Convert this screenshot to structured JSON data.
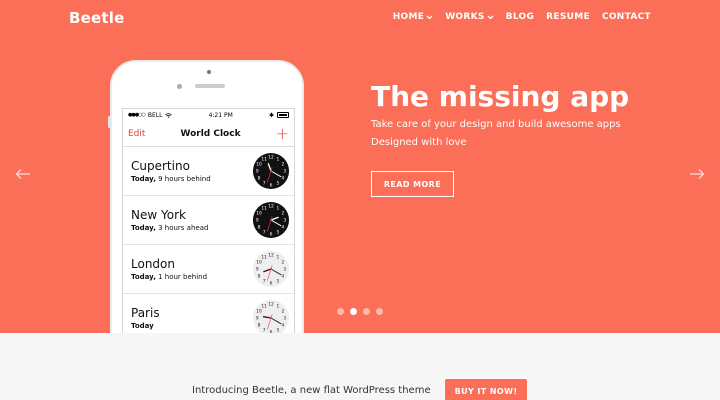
{
  "brand": {
    "logo": "Beetle"
  },
  "nav": {
    "items": [
      {
        "label": "HOME",
        "has_dropdown": true
      },
      {
        "label": "WORKS",
        "has_dropdown": true
      },
      {
        "label": "BLOG",
        "has_dropdown": false
      },
      {
        "label": "RESUME",
        "has_dropdown": false
      },
      {
        "label": "CONTACT",
        "has_dropdown": false
      }
    ]
  },
  "phone": {
    "status": {
      "carrier": "BELL",
      "time": "4:21 PM",
      "battery_symbol": "✱"
    },
    "app": {
      "edit": "Edit",
      "title": "World Clock",
      "add": "+"
    },
    "clocks": [
      {
        "city": "Cupertino",
        "day": "Today,",
        "offset": "9 hours behind",
        "theme": "dark",
        "hour": 11,
        "minute": 20
      },
      {
        "city": "New York",
        "day": "Today,",
        "offset": "3 hours ahead",
        "theme": "dark",
        "hour": 2,
        "minute": 20
      },
      {
        "city": "London",
        "day": "Today,",
        "offset": "1 hour behind",
        "theme": "light",
        "hour": 8,
        "minute": 20
      },
      {
        "city": "Paris",
        "day": "Today",
        "offset": "",
        "theme": "light",
        "hour": 9,
        "minute": 20
      }
    ]
  },
  "hero": {
    "title": "The missing app",
    "subtitle_1": "Take care of your design and build awesome apps",
    "subtitle_2": "Designed with love",
    "cta": "READ MORE"
  },
  "slider": {
    "count": 4,
    "active": 1
  },
  "promo": {
    "text": "Introducing Beetle, a new flat WordPress theme",
    "cta": "BUY IT NOW!"
  },
  "colors": {
    "brand": "#fb6e57",
    "accent_red": "#e84236",
    "clock_dark": "#111111",
    "clock_light": "#eeeeee"
  },
  "icons": {
    "prev": "arrow-left-icon",
    "next": "arrow-right-icon",
    "dropdown": "chevron-down-icon"
  }
}
